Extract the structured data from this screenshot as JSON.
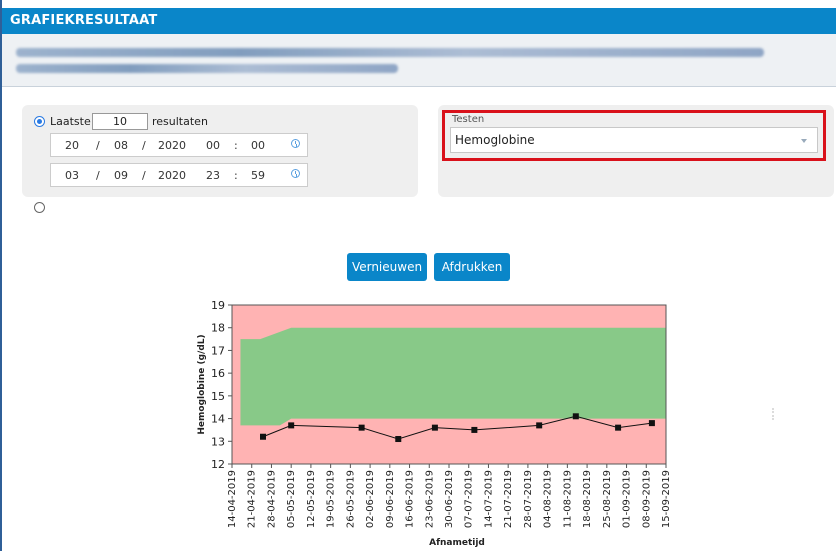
{
  "window": {
    "title": "GRAFIEKRESULTAAT"
  },
  "filter": {
    "latest_label": "Laatste",
    "latest_count": "10",
    "results_label": "resultaten",
    "from": {
      "day": "20",
      "month": "08",
      "year": "2020",
      "hour": "00",
      "minute": "00"
    },
    "to": {
      "day": "03",
      "month": "09",
      "year": "2020",
      "hour": "23",
      "minute": "59"
    },
    "date_sep": "/",
    "time_sep": ":"
  },
  "tests": {
    "label": "Testen",
    "selected": "Hemoglobine"
  },
  "actions": {
    "refresh_label": "Vernieuwen",
    "print_label": "Afdrukken"
  },
  "colors": {
    "accent": "#0a86c9",
    "normal_band": "#88c988",
    "out_of_range": "#ffb3b3",
    "highlight": "#d9111b"
  },
  "chart_data": {
    "type": "line",
    "ylabel": "Hemoglobine (g/dL)",
    "xlabel": "Afnametijd",
    "ylim": [
      12,
      19
    ],
    "yticks": [
      12,
      13,
      14,
      15,
      16,
      17,
      18,
      19
    ],
    "xticks": [
      "14-04-2019",
      "21-04-2019",
      "28-04-2019",
      "05-05-2019",
      "12-05-2019",
      "19-05-2019",
      "26-05-2019",
      "02-06-2019",
      "09-06-2019",
      "16-06-2019",
      "23-06-2019",
      "30-06-2019",
      "07-07-2019",
      "14-07-2019",
      "21-07-2019",
      "28-07-2019",
      "04-08-2019",
      "11-08-2019",
      "18-08-2019",
      "25-08-2019",
      "01-09-2019",
      "08-09-2019",
      "15-09-2019"
    ],
    "series": [
      {
        "values": [
          {
            "x": "2019-04-25",
            "y": 13.2
          },
          {
            "x": "2019-05-05",
            "y": 13.7
          },
          {
            "x": "2019-05-30",
            "y": 13.6
          },
          {
            "x": "2019-06-12",
            "y": 13.1
          },
          {
            "x": "2019-06-25",
            "y": 13.6
          },
          {
            "x": "2019-07-09",
            "y": 13.5
          },
          {
            "x": "2019-08-01",
            "y": 13.7
          },
          {
            "x": "2019-08-14",
            "y": 14.1
          },
          {
            "x": "2019-08-29",
            "y": 13.6
          },
          {
            "x": "2019-09-10",
            "y": 13.8
          }
        ]
      }
    ],
    "reference_range": {
      "lower": [
        {
          "x": "2019-04-17",
          "y": 13.7
        },
        {
          "x": "2019-05-01",
          "y": 13.7
        },
        {
          "x": "2019-05-05",
          "y": 14.0
        },
        {
          "x": "2019-09-15",
          "y": 14.0
        }
      ],
      "upper": [
        {
          "x": "2019-04-17",
          "y": 17.5
        },
        {
          "x": "2019-04-24",
          "y": 17.5
        },
        {
          "x": "2019-05-05",
          "y": 18.0
        },
        {
          "x": "2019-09-15",
          "y": 18.0
        }
      ]
    }
  }
}
